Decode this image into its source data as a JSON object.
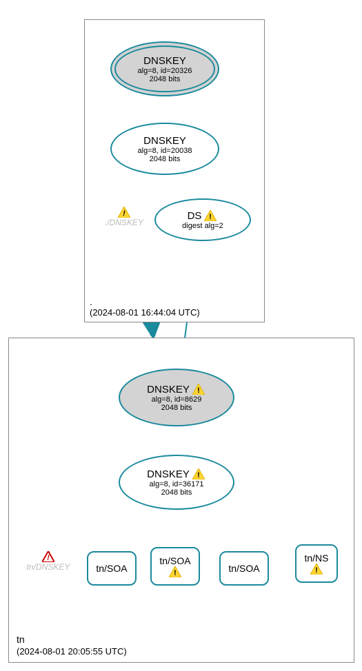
{
  "zones": {
    "root": {
      "name": ".",
      "timestamp": "(2024-08-01 16:44:04 UTC)"
    },
    "tn": {
      "name": "tn",
      "timestamp": "(2024-08-01 20:05:55 UTC)"
    }
  },
  "nodes": {
    "root_ksk": {
      "title": "DNSKEY",
      "line1": "alg=8, id=20326",
      "line2": "2048 bits"
    },
    "root_zsk": {
      "title": "DNSKEY",
      "line1": "alg=8, id=20038",
      "line2": "2048 bits"
    },
    "ds": {
      "title": "DS",
      "line1": "digest alg=2"
    },
    "tn_ksk": {
      "title": "DNSKEY",
      "line1": "alg=8, id=8629",
      "line2": "2048 bits"
    },
    "tn_zsk": {
      "title": "DNSKEY",
      "line1": "alg=8, id=36171",
      "line2": "2048 bits"
    },
    "rr1": {
      "label": "tn/SOA"
    },
    "rr2": {
      "label": "tn/SOA"
    },
    "rr3": {
      "label": "tn/SOA"
    },
    "rr4": {
      "label": "tn/NS"
    }
  },
  "ghosts": {
    "root_dnskey": "./DNSKEY",
    "tn_dnskey": "tn/DNSKEY"
  },
  "chart_data": {
    "type": "directed-graph",
    "zones": [
      {
        "id": "root",
        "label": ".",
        "timestamp": "2024-08-01 16:44:04 UTC"
      },
      {
        "id": "tn",
        "label": "tn",
        "timestamp": "2024-08-01 20:05:55 UTC"
      }
    ],
    "nodes": [
      {
        "id": "root_ksk",
        "zone": "root",
        "type": "DNSKEY",
        "alg": 8,
        "key_id": 20326,
        "bits": 2048,
        "ksk": true,
        "warning": false
      },
      {
        "id": "root_zsk",
        "zone": "root",
        "type": "DNSKEY",
        "alg": 8,
        "key_id": 20038,
        "bits": 2048,
        "ksk": false,
        "warning": false
      },
      {
        "id": "ds",
        "zone": "root",
        "type": "DS",
        "digest_alg": 2,
        "warning": true
      },
      {
        "id": "root_dnskey_ghost",
        "zone": "root",
        "type": "ghost",
        "label": "./DNSKEY",
        "warning": true
      },
      {
        "id": "tn_ksk",
        "zone": "tn",
        "type": "DNSKEY",
        "alg": 8,
        "key_id": 8629,
        "bits": 2048,
        "ksk": true,
        "warning": true
      },
      {
        "id": "tn_zsk",
        "zone": "tn",
        "type": "DNSKEY",
        "alg": 8,
        "key_id": 36171,
        "bits": 2048,
        "ksk": false,
        "warning": true
      },
      {
        "id": "tn_dnskey_ghost",
        "zone": "tn",
        "type": "ghost",
        "label": "tn/DNSKEY",
        "error": true
      },
      {
        "id": "rr1",
        "zone": "tn",
        "type": "RRset",
        "label": "tn/SOA",
        "warning": false
      },
      {
        "id": "rr2",
        "zone": "tn",
        "type": "RRset",
        "label": "tn/SOA",
        "warning": true
      },
      {
        "id": "rr3",
        "zone": "tn",
        "type": "RRset",
        "label": "tn/SOA",
        "warning": false
      },
      {
        "id": "rr4",
        "zone": "tn",
        "type": "RRset",
        "label": "tn/NS",
        "warning": true
      }
    ],
    "edges": [
      {
        "from": "root_ksk",
        "to": "root_ksk",
        "self": true
      },
      {
        "from": "root_ksk",
        "to": "root_zsk"
      },
      {
        "from": "root_zsk",
        "to": "ds"
      },
      {
        "from": "ds",
        "to": "tn_ksk"
      },
      {
        "from": "root",
        "to": "tn",
        "zone_edge": true
      },
      {
        "from": "tn_ksk",
        "to": "tn_ksk",
        "self": true
      },
      {
        "from": "tn_ksk",
        "to": "tn_zsk"
      },
      {
        "from": "tn_zsk",
        "to": "tn_zsk",
        "self": true
      },
      {
        "from": "tn_zsk",
        "to": "rr1"
      },
      {
        "from": "tn_zsk",
        "to": "rr2"
      },
      {
        "from": "tn_zsk",
        "to": "rr3"
      },
      {
        "from": "tn_zsk",
        "to": "rr4"
      }
    ]
  }
}
